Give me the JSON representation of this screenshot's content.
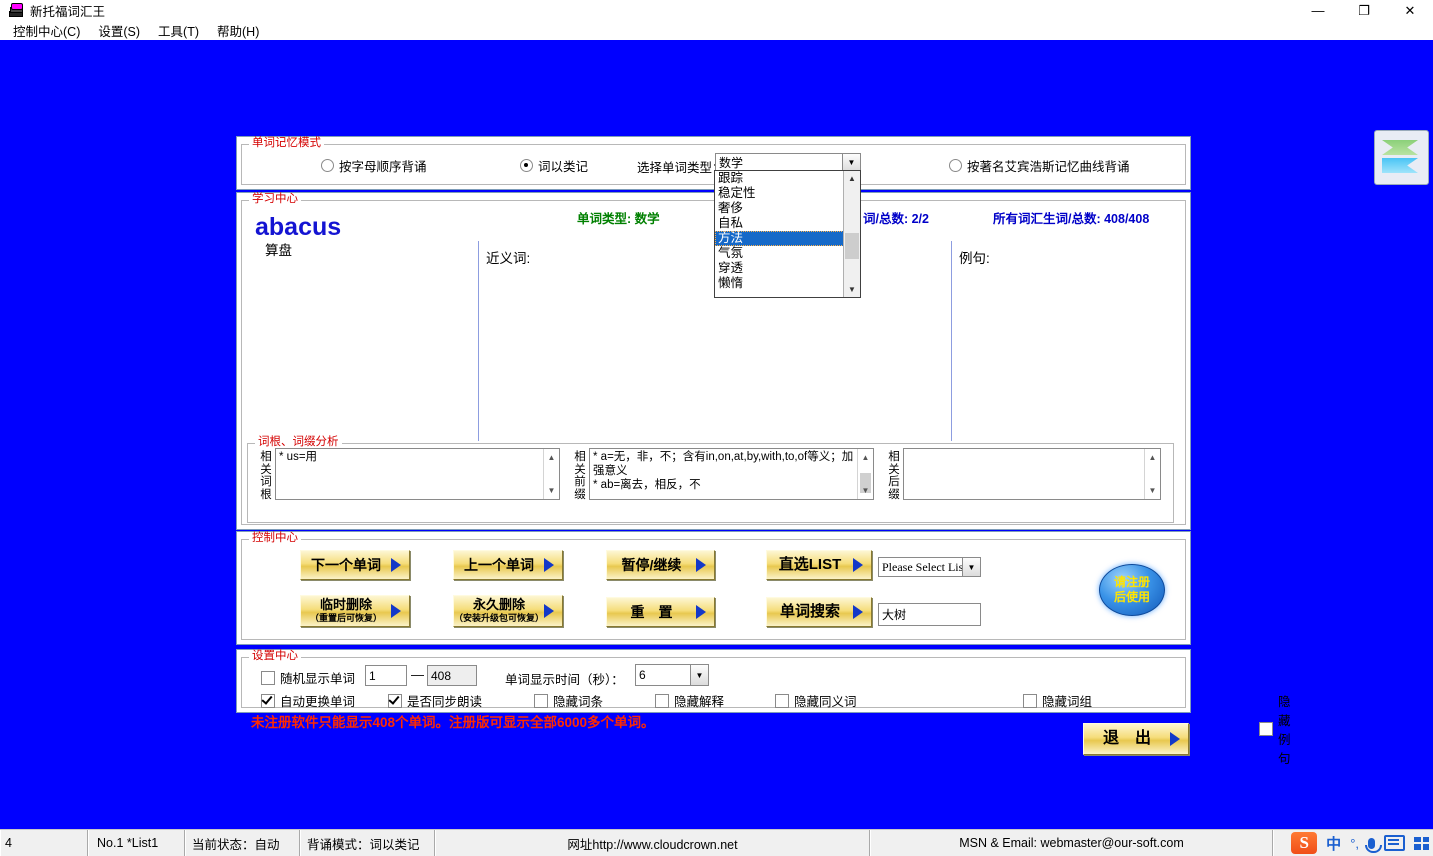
{
  "window": {
    "title": "新托福词汇王",
    "minimize": "—",
    "maximize": "❐",
    "close": "✕"
  },
  "menu": [
    {
      "label": "控制中心(C)"
    },
    {
      "label": "设置(S)"
    },
    {
      "label": "工具(T)"
    },
    {
      "label": "帮助(H)"
    }
  ],
  "memory_mode": {
    "group_title": "单词记忆模式",
    "option_alpha": "按字母顺序背诵",
    "option_category": "词以类记",
    "type_label": "选择单词类型：",
    "type_value": "数学",
    "option_ebbinghaus": "按著名艾宾浩斯记忆曲线背诵",
    "dropdown_options": [
      "跟踪",
      "稳定性",
      "奢侈",
      "自私",
      "方法",
      "气氛",
      "穿透",
      "懒惰"
    ],
    "dropdown_selected": "方法"
  },
  "study": {
    "group_title": "学习中心",
    "word": "abacus",
    "meaning": "算盘",
    "word_type": "单词类型: 数学",
    "category_count": "词/总数: 2/2",
    "total_count": "所有词汇生词/总数: 408/408",
    "synonym_label": "近义词:",
    "example_label": "例句:",
    "synonym_value": "",
    "example_value": ""
  },
  "roots": {
    "group_title": "词根、词缀分析",
    "root_label": "相关词根",
    "prefix_label": "相关前缀",
    "suffix_label": "相关后缀",
    "root_text": "* us=用",
    "prefix_text": "* a=无，非，不；含有in,on,at,by,with,to,of等义；加强意义\n* ab=离去，相反，不",
    "suffix_text": ""
  },
  "control": {
    "group_title": "控制中心",
    "next_word": "下一个单词",
    "prev_word": "上一个单词",
    "pause_resume": "暂停/继续",
    "direct_list": "直选LIST",
    "list_select_value": "Please Select List",
    "temp_delete": "临时删除",
    "temp_delete_sub": "（重置后可恢复）",
    "perm_delete": "永久删除",
    "perm_delete_sub": "（安装升级包可恢复）",
    "reset": "重　置",
    "word_search": "单词搜索",
    "search_value": "大树",
    "register_line1": "请注册",
    "register_line2": "后使用"
  },
  "settings": {
    "group_title": "设置中心",
    "random_display": "随机显示单词",
    "range_from": "1",
    "range_dash": "—",
    "range_to": "408",
    "auto_change": "自动更换单词",
    "sync_read": "是否同步朗读",
    "display_time_label": "单词显示时间（秒）：",
    "display_time_value": "6",
    "hide_entry": "隐藏词条",
    "hide_explain": "隐藏解释",
    "hide_synonym": "隐藏同义词",
    "hide_phrase": "隐藏词组",
    "hide_example": "隐藏例句"
  },
  "notice": "未注册软件只能显示408个单词。注册版可显示全部6000多个单词。",
  "exit_button": "退　出",
  "statusbar": {
    "cell_cut": "4",
    "list": "No.1 *List1",
    "state": "当前状态：自动",
    "mode": "背诵模式：词以类记",
    "website": "网址http://www.cloudcrown.net",
    "contact": "MSN & Email: webmaster@our-soft.com"
  },
  "tray": {
    "sogou": "S",
    "lang": "中",
    "punct": "°,",
    "mic": "microphone-icon",
    "keyboard": "keyboard-icon",
    "apps": "apps-grid-icon"
  },
  "colors": {
    "desktop": "#0000FF",
    "group_title": "#d40000",
    "accent_blue": "#0000c8",
    "accent_green": "#008000",
    "notice_red": "#ff2a00",
    "gold": "#f5dd7a"
  }
}
